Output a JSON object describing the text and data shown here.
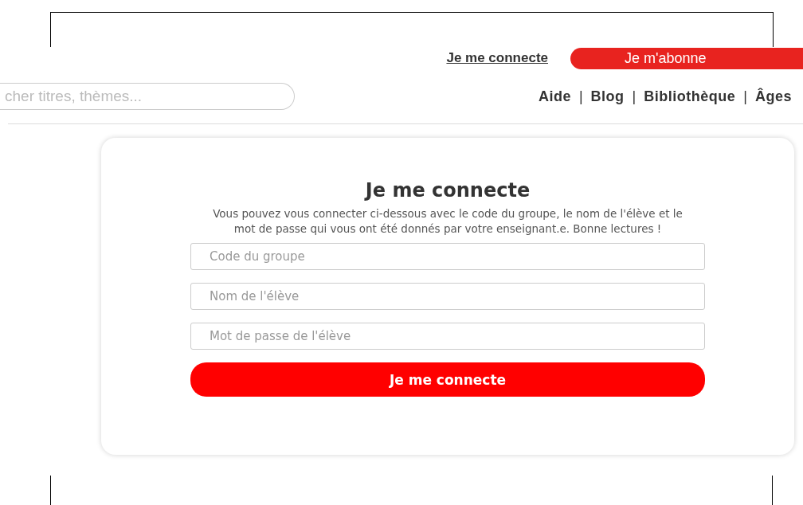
{
  "header": {
    "login_link": "Je me connecte",
    "subscribe_button": "Je m'abonne",
    "search": {
      "placeholder": "cher titres, thèmes..."
    },
    "nav": [
      {
        "kind": "link",
        "label": "Aide"
      },
      {
        "kind": "separator",
        "label": "|"
      },
      {
        "kind": "link",
        "label": "Blog"
      },
      {
        "kind": "separator",
        "label": "|"
      },
      {
        "kind": "link",
        "label": "Bibliothèque"
      },
      {
        "kind": "separator",
        "label": "|"
      },
      {
        "kind": "link",
        "label": "Âges"
      }
    ]
  },
  "login_card": {
    "title": "Je me connecte",
    "description": "Vous pouvez vous connecter ci-dessous avec le code du groupe, le nom de l'élève et le mot de passe qui vous ont été donnés par votre enseignant.e. Bonne lectures !",
    "fields": [
      {
        "placeholder": "Code du groupe"
      },
      {
        "placeholder": "Nom de l'élève"
      },
      {
        "placeholder": "Mot de passe de l'élève"
      }
    ],
    "submit_button": "Je me connecte"
  }
}
